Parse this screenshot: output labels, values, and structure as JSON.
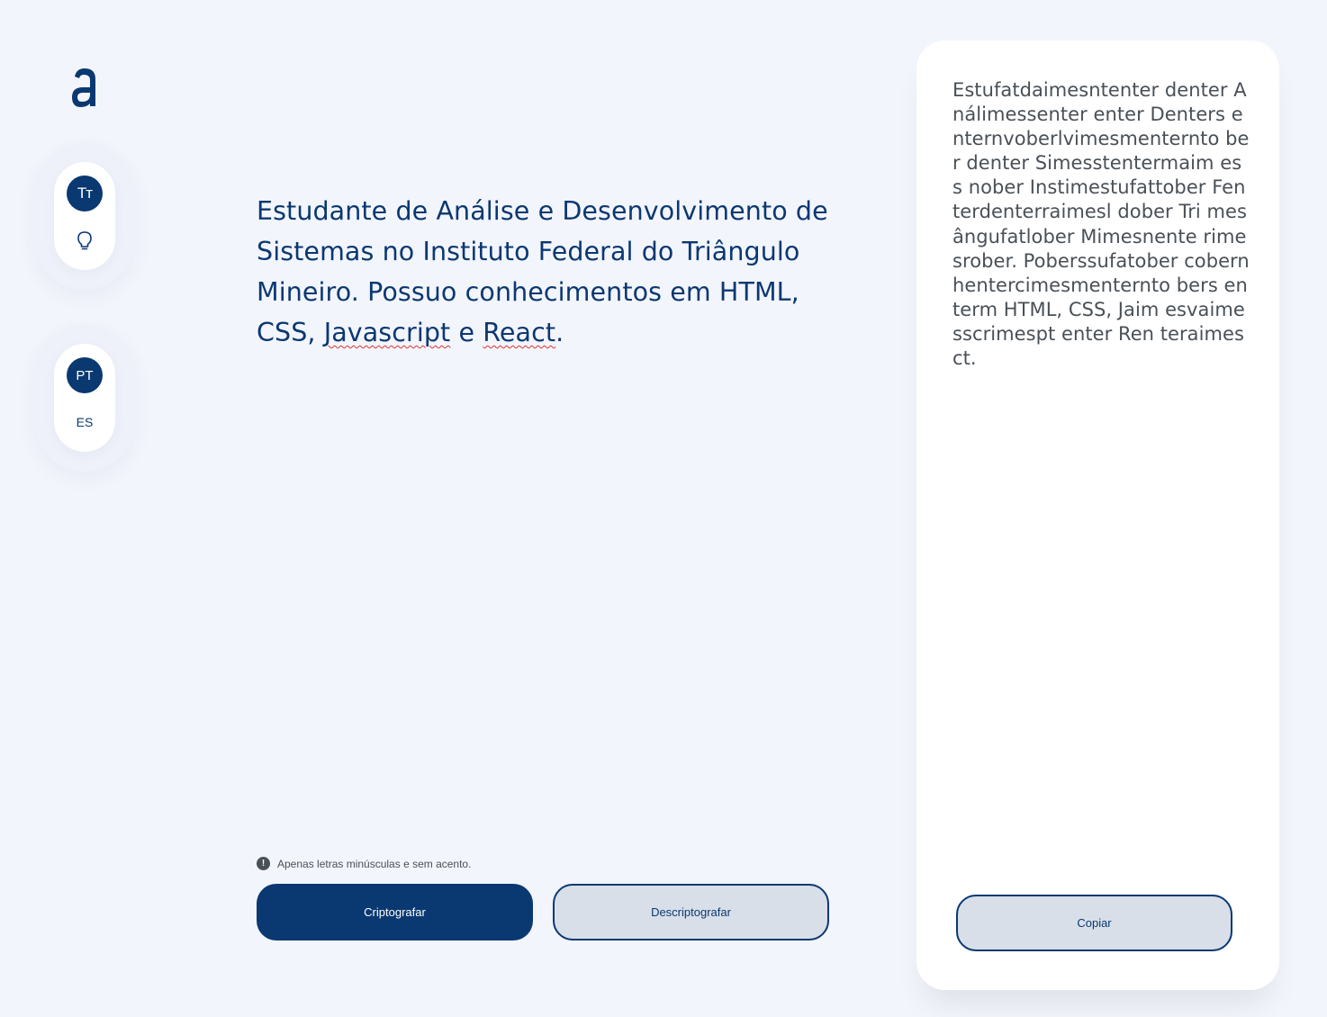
{
  "sidebar": {
    "logo_icon": "alura-logo",
    "font_toggle": {
      "label": "Tт",
      "icon": "text-size-icon"
    },
    "theme_toggle": {
      "icon": "lightbulb-icon"
    },
    "languages": [
      "PT",
      "ES"
    ]
  },
  "input": {
    "text_parts": [
      "Estudante de Análise e Desenvolvimento de Sistemas no Instituto Federal do Triângulo Mineiro. Possuo conhecimentos em HTML, CSS, ",
      "Javascript",
      " e ",
      "React",
      "."
    ]
  },
  "hint": {
    "icon": "info-circle-icon",
    "text": "Apenas letras minúsculas e sem acento."
  },
  "buttons": {
    "encrypt": "Criptografar",
    "decrypt": "Descriptografar",
    "copy": "Copiar"
  },
  "output": {
    "text": "Estufatdaimesntenter denter Análimessenter enter Denters enternvoberlvimesmenternto ber denter Simesstentermaim ess nober Instimestufattober Fenterdenterraimesl dober Tri mesângufatlober Mimesnente rimesrober. Poberssufatober cobernhentercimesmenternto bers enterm HTML, CSS, Jaim esvaimesscrimespt enter Ren teraimesct."
  },
  "colors": {
    "background": "#f3f5fc",
    "primary": "#0a3871",
    "secondary_bg": "#d8dfe8",
    "text_gray": "#495057",
    "spell_underline": "#dd3333"
  }
}
